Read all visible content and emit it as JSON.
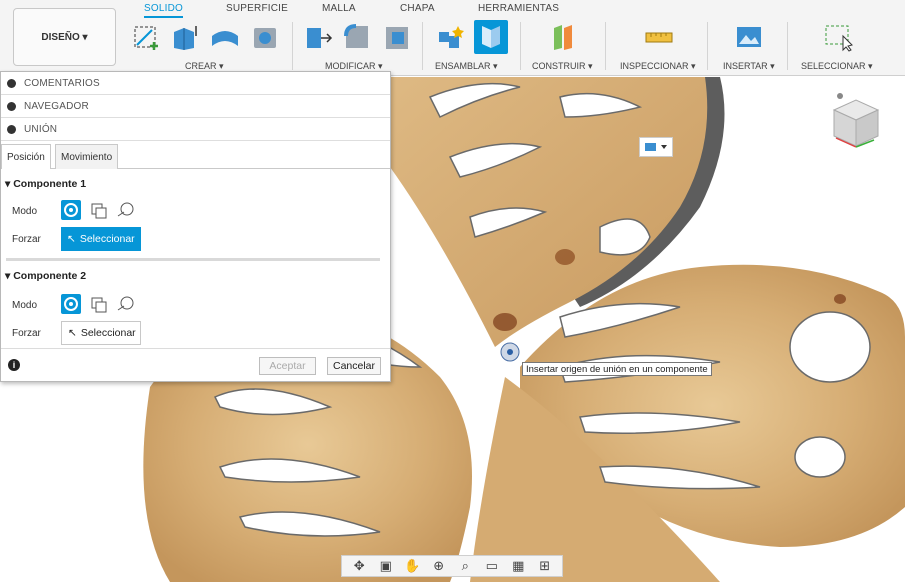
{
  "ribbon": {
    "design_label": "DISEÑO ▾",
    "tabs": [
      "SOLIDO",
      "SUPERFICIE",
      "MALLA",
      "CHAPA",
      "HERRAMIENTAS"
    ],
    "groups": [
      "CREAR ▾",
      "MODIFICAR ▾",
      "ENSAMBLAR ▾",
      "CONSTRUIR ▾",
      "INSPECCIONAR ▾",
      "INSERTAR ▾",
      "SELECCIONAR ▾"
    ]
  },
  "panel": {
    "sections": [
      "COMENTARIOS",
      "NAVEGADOR",
      "UNIÓN"
    ],
    "tabs": [
      "Posición",
      "Movimiento"
    ],
    "component1": {
      "title": "Componente 1",
      "mode_label": "Modo",
      "force_label": "Forzar",
      "select_label": "Seleccionar"
    },
    "component2": {
      "title": "Componente 2",
      "mode_label": "Modo",
      "force_label": "Forzar",
      "select_label": "Seleccionar"
    },
    "accept_label": "Aceptar",
    "cancel_label": "Cancelar"
  },
  "tooltip": "Insertar origen de unión en un componente",
  "colors": {
    "accent": "#0696d7",
    "wood": "#d9b27a",
    "wood_dark": "#b6854a",
    "edge": "#6e6e6e"
  }
}
